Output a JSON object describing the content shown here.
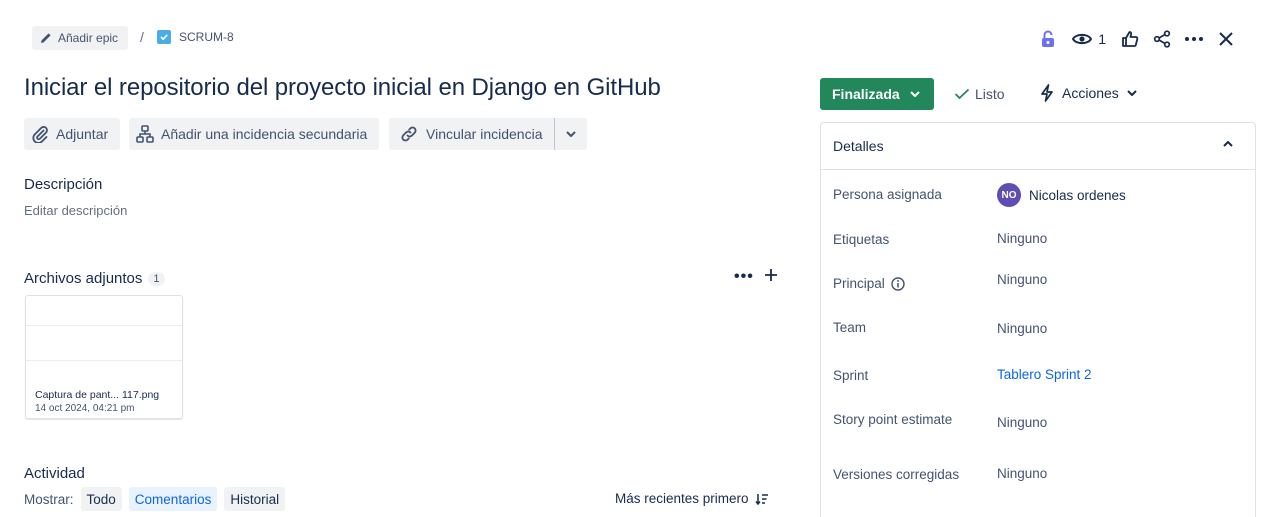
{
  "breadcrumb": {
    "epic_label": "Añadir epic",
    "separator": "/",
    "issue_key": "SCRUM-8"
  },
  "toolbar": {
    "watch_count": "1"
  },
  "issue": {
    "title": "Iniciar el repositorio del proyecto inicial en Django en GitHub"
  },
  "actions": {
    "attach": "Adjuntar",
    "add_child": "Añadir una incidencia secundaria",
    "link": "Vincular incidencia"
  },
  "description": {
    "heading": "Descripción",
    "placeholder": "Editar descripción"
  },
  "attachments": {
    "heading": "Archivos adjuntos",
    "count": "1",
    "more": "•••",
    "items": [
      {
        "name": "Captura de pant... 117.png",
        "date": "14 oct 2024, 04:21 pm"
      }
    ]
  },
  "activity": {
    "heading": "Actividad",
    "show_label": "Mostrar:",
    "filters": [
      "Todo",
      "Comentarios",
      "Historial"
    ],
    "active_filter": "Comentarios",
    "sort": "Más recientes primero"
  },
  "status": {
    "label": "Finalizada",
    "resolution": "Listo",
    "actions_label": "Acciones"
  },
  "details": {
    "heading": "Detalles",
    "fields": [
      {
        "label": "Persona asignada",
        "value": "Nicolas ordenes",
        "avatar": "NO"
      },
      {
        "label": "Etiquetas",
        "value": "Ninguno"
      },
      {
        "label": "Principal",
        "value": "Ninguno"
      },
      {
        "label": "Team",
        "value": "Ninguno"
      },
      {
        "label": "Sprint",
        "value": "Tablero Sprint 2"
      },
      {
        "label": "Story point estimate",
        "value": "Ninguno"
      },
      {
        "label": "Versiones corregidas",
        "value": "Ninguno"
      }
    ]
  },
  "colors": {
    "status_green": "#22875a",
    "link_blue": "#0c66e4",
    "lock_purple": "#6b6ff0",
    "avatar_purple": "#5e4db2"
  }
}
